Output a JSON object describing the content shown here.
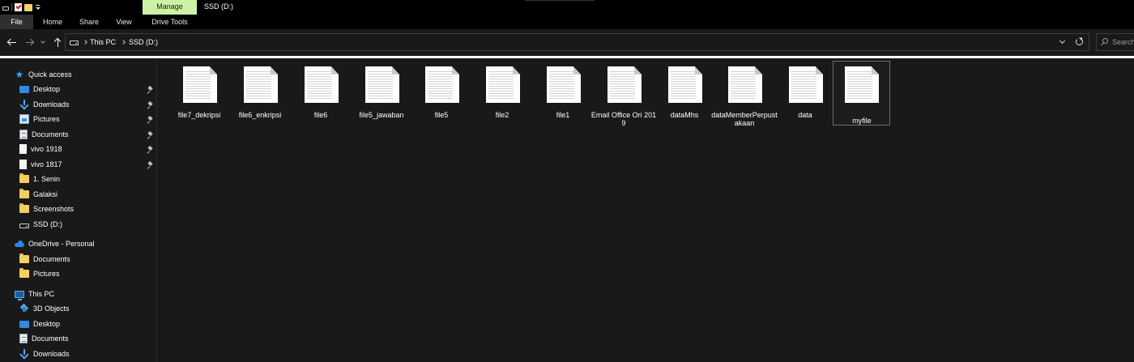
{
  "titlebar": {
    "manage_label": "Manage",
    "window_title": "SSD (D:)",
    "quick_access_toolbar": [
      "drive-icon",
      "properties-check-icon",
      "new-folder-icon",
      "customize-dropdown-icon"
    ]
  },
  "ribbon": {
    "tabs": [
      {
        "label": "File"
      },
      {
        "label": "Home"
      },
      {
        "label": "Share"
      },
      {
        "label": "View"
      },
      {
        "label": "Drive Tools"
      }
    ]
  },
  "address": {
    "crumbs": [
      "This PC",
      "SSD (D:)"
    ],
    "search_placeholder": "Search SSD (D:)"
  },
  "nav": {
    "quick_access": {
      "label": "Quick access",
      "items": [
        {
          "label": "Desktop",
          "icon": "desktop-icon",
          "pinned": true
        },
        {
          "label": "Downloads",
          "icon": "downloads-icon",
          "pinned": true
        },
        {
          "label": "Pictures",
          "icon": "pictures-icon",
          "pinned": true
        },
        {
          "label": "Documents",
          "icon": "documents-icon",
          "pinned": true
        },
        {
          "label": "vivo 1918",
          "icon": "file-icon",
          "pinned": true
        },
        {
          "label": "vivo 1817",
          "icon": "file-icon",
          "pinned": true
        },
        {
          "label": "1. Senin",
          "icon": "folder-icon",
          "pinned": false
        },
        {
          "label": "Galaksi",
          "icon": "folder-icon",
          "pinned": false
        },
        {
          "label": "Screenshots",
          "icon": "folder-icon",
          "pinned": false
        },
        {
          "label": "SSD (D:)",
          "icon": "drive-icon",
          "pinned": false
        }
      ]
    },
    "onedrive": {
      "label": "OneDrive - Personal",
      "items": [
        {
          "label": "Documents",
          "icon": "folder-icon"
        },
        {
          "label": "Pictures",
          "icon": "folder-icon"
        }
      ]
    },
    "this_pc": {
      "label": "This PC",
      "items": [
        {
          "label": "3D Objects",
          "icon": "3d-objects-icon"
        },
        {
          "label": "Desktop",
          "icon": "desktop-icon"
        },
        {
          "label": "Documents",
          "icon": "documents-icon"
        },
        {
          "label": "Downloads",
          "icon": "downloads-icon"
        }
      ]
    }
  },
  "files": [
    {
      "name": "file7_dekripsi"
    },
    {
      "name": "file6_enkripsi"
    },
    {
      "name": "file6"
    },
    {
      "name": "file5_jawaban"
    },
    {
      "name": "file5"
    },
    {
      "name": "file2"
    },
    {
      "name": "file1"
    },
    {
      "name": "Email Office Ori 2019"
    },
    {
      "name": "dataMhs"
    },
    {
      "name": "dataMemberPerpustakaan"
    },
    {
      "name": "data"
    },
    {
      "name": "myfile",
      "selected": true
    }
  ],
  "colors": {
    "background": "#191919",
    "titlebar": "#000000",
    "manage_tab": "#cdf2a5",
    "accent_blue": "#3aa0ff",
    "folder": "#f3cf62"
  }
}
